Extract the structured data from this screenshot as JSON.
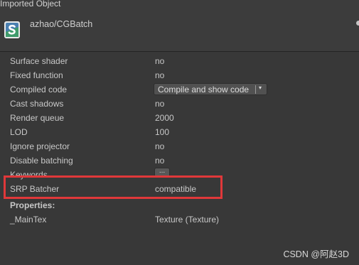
{
  "window": {
    "title": "Imported Object"
  },
  "asset": {
    "name": "azhao/CGBatch",
    "icon": "shader-asset-icon"
  },
  "properties": {
    "surface_shader": {
      "label": "Surface shader",
      "value": "no"
    },
    "fixed_function": {
      "label": "Fixed function",
      "value": "no"
    },
    "compiled_code": {
      "label": "Compiled code",
      "button": "Compile and show code",
      "arrow": "▾"
    },
    "cast_shadows": {
      "label": "Cast shadows",
      "value": "no"
    },
    "render_queue": {
      "label": "Render queue",
      "value": "2000"
    },
    "lod": {
      "label": "LOD",
      "value": "100"
    },
    "ignore_projector": {
      "label": "Ignore projector",
      "value": "no"
    },
    "disable_batching": {
      "label": "Disable batching",
      "value": "no"
    },
    "keywords": {
      "label": "Keywords",
      "button": "..."
    },
    "srp_batcher": {
      "label": "SRP Batcher",
      "value": "compatible"
    },
    "properties_header": "Properties:",
    "main_tex": {
      "label": "_MainTex",
      "value": "Texture (Texture)"
    }
  },
  "highlight_color": "#e0383a",
  "watermark": "CSDN @阿赵3D"
}
